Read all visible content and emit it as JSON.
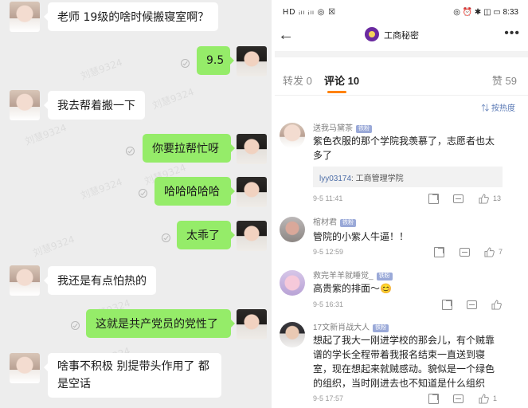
{
  "chat": {
    "watermark": "刘慧9324",
    "messages": [
      {
        "side": "left",
        "text": "老师 19级的啥时候搬寝室啊？"
      },
      {
        "side": "right",
        "text": "9.5"
      },
      {
        "side": "left",
        "text": "我去帮着搬一下"
      },
      {
        "side": "right",
        "text": "你要拉帮忙呀"
      },
      {
        "side": "right",
        "text": "哈哈哈哈哈"
      },
      {
        "side": "right",
        "text": "太乖了"
      },
      {
        "side": "left",
        "text": "我还是有点怕热的"
      },
      {
        "side": "right",
        "text": "这就是共产党员的党性了"
      },
      {
        "side": "left",
        "text_line1": "啥事不积极 别提带头作用了 都",
        "text_line2": "是空话"
      }
    ]
  },
  "status_bar": {
    "signal": "HD ᵢₗₗ ᵢₗₗ ◎ ☒",
    "right": "◎ ⏰ ✱ ◫ ▭ 8:33"
  },
  "app": {
    "title": "工商秘密",
    "back_icon": "arrow-left-icon",
    "more_icon": "more-dots-icon",
    "tabs": [
      {
        "label": "转发 0"
      },
      {
        "label": "评论 10"
      },
      {
        "label": "赞 59"
      }
    ],
    "sort_label": "按热度",
    "comments": [
      {
        "name": "送我马黛茶",
        "badge": "铁粉",
        "text_line1": "紫色衣服的那个学院我羡慕了，志愿者也太",
        "text_line2": "多了",
        "reply_user": "lyy03174",
        "reply_text": ": 工商管理学院",
        "time": "9-5 11:41",
        "likes": "13"
      },
      {
        "name": "棺材君",
        "badge": "铁粉",
        "text_line1": "管院的小紫人牛逼！！",
        "time": "9-5 12:59",
        "likes": "7"
      },
      {
        "name": "救完羊羊就睡觉_",
        "badge": "铁粉",
        "text_line1": "高贵紫的排面～😊",
        "time": "9-5 16:31",
        "likes": ""
      },
      {
        "name": "17文新肖战大人",
        "badge": "铁粉",
        "text_line1": "想起了我大一刚进学校的那会儿，有个贼靠",
        "text_line2": "谱的学长全程带着我报名结束一直送到寝",
        "text_line3": "室，现在想起来就贼感动。貌似是一个绿色",
        "text_line4": "的组织，当时刚进去也不知道是什么组织",
        "time": "9-5 17:57",
        "likes": "1"
      }
    ]
  }
}
